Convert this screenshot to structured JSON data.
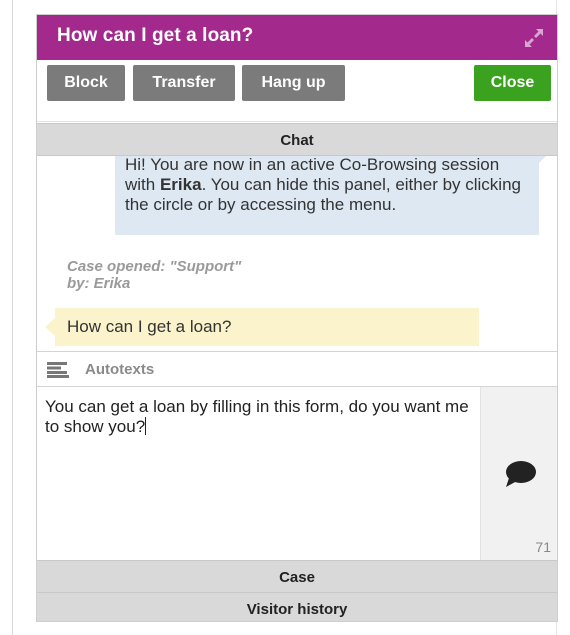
{
  "header": {
    "title": "How can I get a loan?",
    "expand_icon": "expand-arrows-icon"
  },
  "toolbar": {
    "block_label": "Block",
    "transfer_label": "Transfer",
    "hangup_label": "Hang up",
    "close_label": "Close"
  },
  "sections": {
    "chat": "Chat",
    "case": "Case",
    "visitor_history": "Visitor history"
  },
  "chat": {
    "agent_message": {
      "before": "Hi! You are now in an active Co-Browsing session with ",
      "name": "Erika",
      "after": ". You can hide this panel, either by clicking the circle or by accessing the menu."
    },
    "case_note_line1": "Case opened: \"Support\"",
    "case_note_line2": "by: Erika",
    "visitor_message": "How can I get a loan?"
  },
  "autotexts": {
    "label": "Autotexts",
    "icon": "lines-icon"
  },
  "compose": {
    "text": "You can get a loan by filling in this form, do you want me to show you?",
    "char_count": "71",
    "send_icon": "speech-bubble-icon"
  },
  "colors": {
    "header_bg": "#a3298c",
    "button_grey": "#7b7b7b",
    "button_green": "#3aa21f",
    "agent_bubble": "#dde8f2",
    "visitor_bubble": "#fbf3cc",
    "section_bar": "#d9d9d9"
  }
}
